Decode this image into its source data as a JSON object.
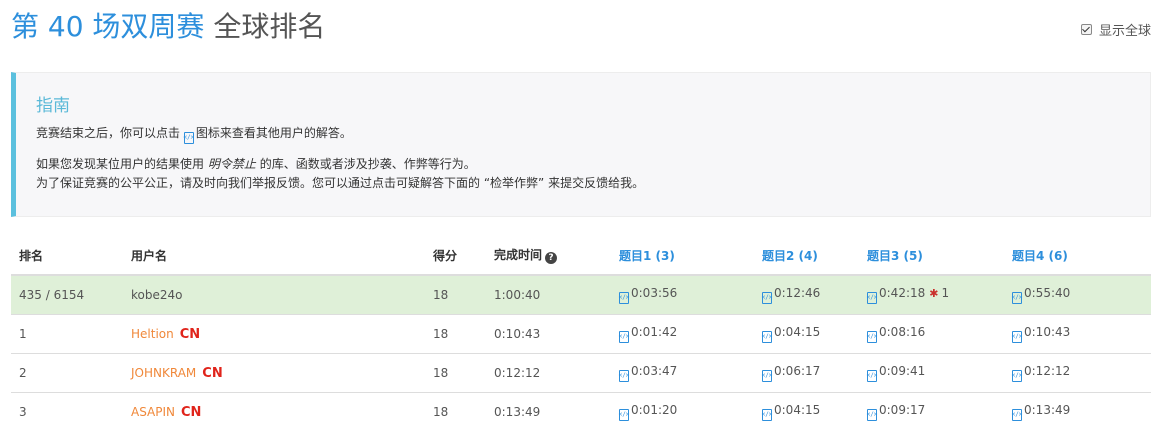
{
  "header": {
    "contest_name": "第 40 场双周赛",
    "title_suffix": "全球排名",
    "show_global_label": "显示全球"
  },
  "guide": {
    "title": "指南",
    "line1_before": "竞赛结束之后，你可以点击",
    "line1_after": "图标来查看其他用户的解答。",
    "line2_before": "如果您发现某位用户的结果使用",
    "line2_em": "明令禁止",
    "line2_after": "的库、函数或者涉及抄袭、作弊等行为。",
    "line3": "为了保证竞赛的公平公正，请及时向我们举报反馈。您可以通过点击可疑解答下面的 “检举作弊” 来提交反馈给我。"
  },
  "table": {
    "headers": {
      "rank": "排名",
      "username": "用户名",
      "score": "得分",
      "finish_time": "完成时间",
      "q1": "题目1 (3)",
      "q2": "题目2 (4)",
      "q3": "题目3 (5)",
      "q4": "题目4 (6)"
    },
    "rows": [
      {
        "rank": "435 / 6154",
        "username": "kobe24o",
        "region": "",
        "score": "18",
        "finish": "1:00:40",
        "q1": "0:03:56",
        "q2": "0:12:46",
        "q3": "0:42:18",
        "q3_penalty": "1",
        "q4": "0:55:40"
      },
      {
        "rank": "1",
        "username": "Heltion",
        "region": "CN",
        "score": "18",
        "finish": "0:10:43",
        "q1": "0:01:42",
        "q2": "0:04:15",
        "q3": "0:08:16",
        "q4": "0:10:43"
      },
      {
        "rank": "2",
        "username": "JOHNKRAM",
        "region": "CN",
        "score": "18",
        "finish": "0:12:12",
        "q1": "0:03:47",
        "q2": "0:06:17",
        "q3": "0:09:41",
        "q4": "0:12:12"
      },
      {
        "rank": "3",
        "username": "ASAPIN",
        "region": "CN",
        "score": "18",
        "finish": "0:13:49",
        "q1": "0:01:20",
        "q2": "0:04:15",
        "q3": "0:09:17",
        "q4": "0:13:49"
      }
    ]
  },
  "icons": {
    "code": "code-file-icon",
    "help": "question-circle-icon",
    "bug": "bug-icon",
    "check": "checkbox-checked-icon"
  },
  "colors": {
    "accent": "#2d8fdc",
    "guide_border": "#5bc0de",
    "self_row": "#dff0d8",
    "username": "#f0883a",
    "region": "#e0241b"
  }
}
